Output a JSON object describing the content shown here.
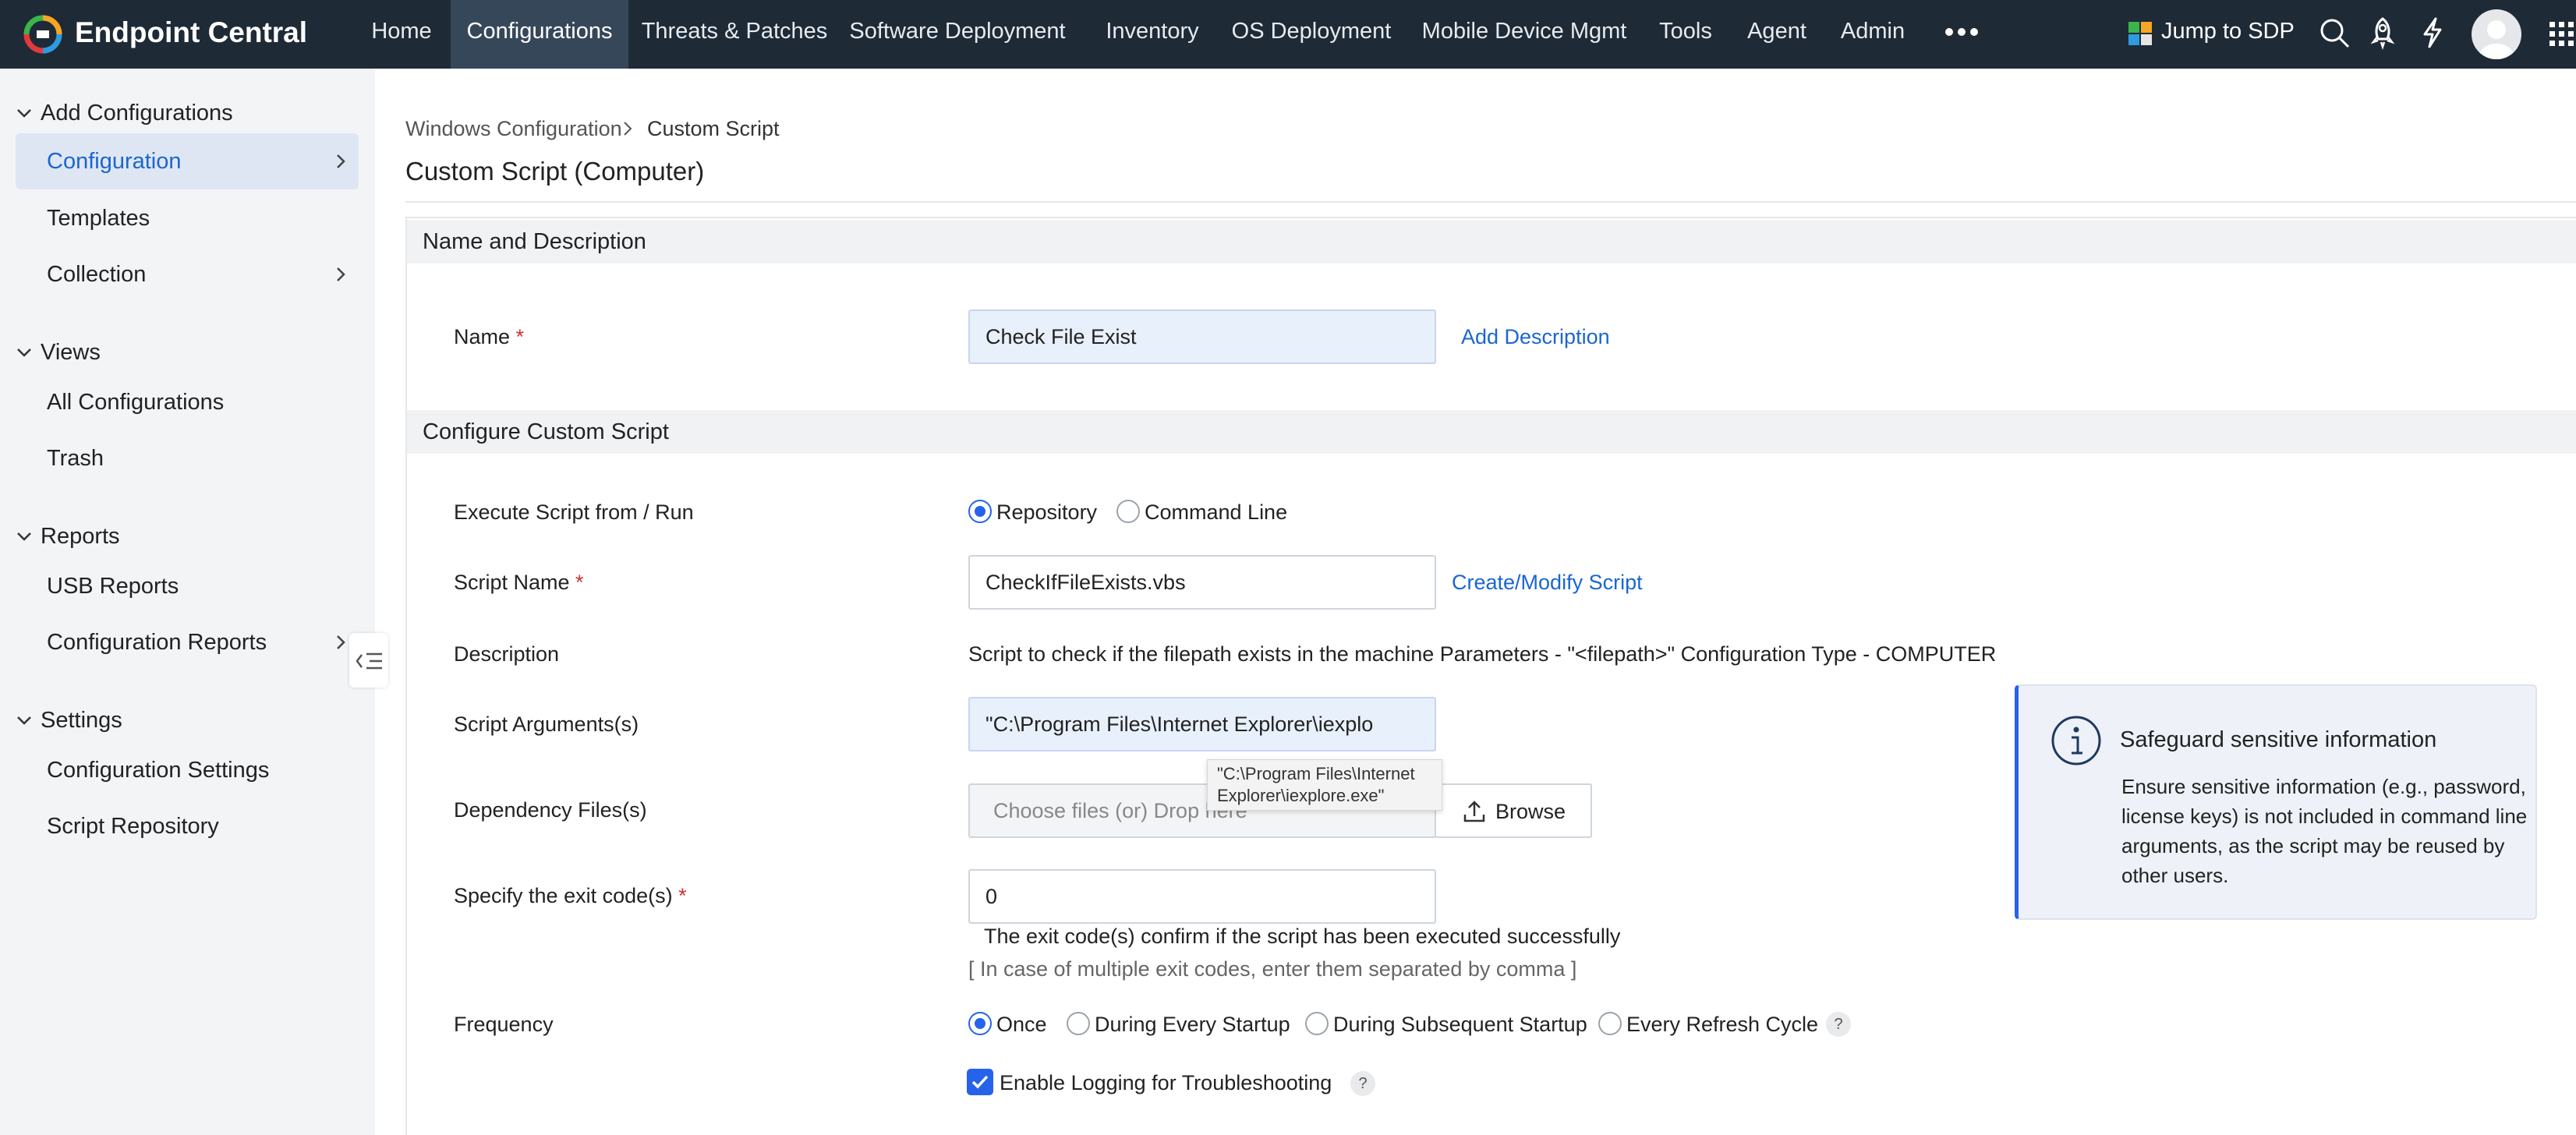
{
  "app": {
    "title": "Endpoint Central",
    "colors": {
      "topbar": "#1f2a37",
      "accent": "#1a66d1",
      "active_nav": "#37475a"
    }
  },
  "nav": {
    "items": [
      "Home",
      "Configurations",
      "Threats & Patches",
      "Software Deployment",
      "Inventory",
      "OS Deployment",
      "Mobile Device Mgmt",
      "Tools",
      "Agent",
      "Admin"
    ],
    "active": "Configurations",
    "more_icon": "more-horizontal-icon",
    "jump_label": "Jump to SDP",
    "icons": [
      "search-icon",
      "rocket-icon",
      "lightning-icon",
      "avatar",
      "apps-grid-icon"
    ]
  },
  "sidebar": {
    "sections": [
      {
        "title": "Add Configurations",
        "items": [
          "Configuration",
          "Templates",
          "Collection"
        ]
      },
      {
        "title": "Views",
        "items": [
          "All Configurations",
          "Trash"
        ]
      },
      {
        "title": "Reports",
        "items": [
          "USB Reports",
          "Configuration Reports"
        ]
      },
      {
        "title": "Settings",
        "items": [
          "Configuration Settings",
          "Script Repository"
        ]
      }
    ],
    "active_item": "Configuration"
  },
  "breadcrumb": {
    "parent": "Windows Configuration",
    "current": "Custom Script"
  },
  "page": {
    "title": "Custom Script (Computer)"
  },
  "section1": {
    "title": "Name and Description",
    "name_label": "Name",
    "name_value": "Check File Exist",
    "add_description": "Add Description"
  },
  "section2": {
    "title": "Configure Custom Script",
    "execute_label": "Execute Script from / Run",
    "execute_options": [
      "Repository",
      "Command Line"
    ],
    "execute_selected": "Repository",
    "script_name_label": "Script Name",
    "script_name_value": "CheckIfFileExists.vbs",
    "create_modify": "Create/Modify Script",
    "description_label": "Description",
    "description_value": "Script to check if the filepath exists in the machine Parameters - \"<filepath>\" Configuration Type - COMPUTER",
    "arguments_label": "Script Arguments(s)",
    "arguments_value": "\"C:\\Program Files\\Internet Explorer\\iexplo",
    "arguments_tooltip": [
      "\"C:\\Program Files\\Internet",
      "Explorer\\iexplore.exe\""
    ],
    "dependency_label": "Dependency Files(s)",
    "dependency_placeholder": "Choose files (or) Drop here",
    "browse": "Browse",
    "exit_code_label": "Specify the exit code(s)",
    "exit_code_value": "0",
    "exit_hint": "The exit code(s) confirm if the script has been executed successfully",
    "exit_hint2": "[ In case of multiple exit codes, enter them separated by comma ]",
    "frequency_label": "Frequency",
    "frequency_options": [
      "Once",
      "During Every Startup",
      "During Subsequent Startup",
      "Every Refresh Cycle"
    ],
    "frequency_selected": "Once",
    "logging_label": "Enable Logging for Troubleshooting",
    "logging_checked": true,
    "help_glyph": "?"
  },
  "info_card": {
    "title": "Safeguard sensitive information",
    "lines": [
      "Ensure sensitive information (e.g., password,",
      "license keys) is not included in command line",
      "arguments, as the script may be reused by",
      "other users."
    ]
  }
}
